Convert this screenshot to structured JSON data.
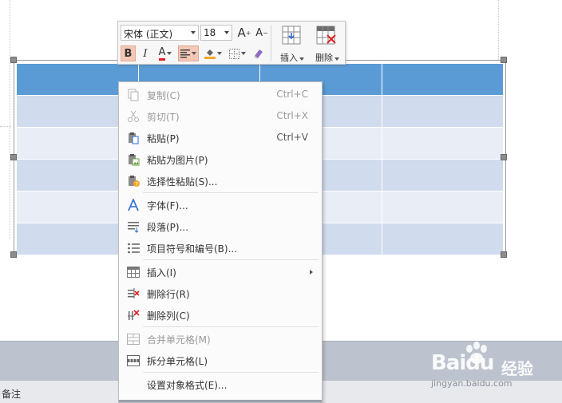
{
  "mini_toolbar": {
    "font_name": "宋体 (正文)",
    "font_size": "18",
    "grow_font_label": "A",
    "shrink_font_label": "A",
    "bold_label": "B",
    "italic_label": "I",
    "font_color_label": "A",
    "insert_label": "插入",
    "delete_label": "删除",
    "colors": {
      "font_color": "#e02020",
      "fill_color": "#f5a623",
      "active_bg": "#f4c7b6"
    }
  },
  "context_menu": {
    "items": [
      {
        "label": "复制(C)",
        "shortcut": "Ctrl+C",
        "icon": "copy-icon",
        "disabled": true
      },
      {
        "label": "剪切(T)",
        "shortcut": "Ctrl+X",
        "icon": "scissors-icon",
        "disabled": true
      },
      {
        "label": "粘贴(P)",
        "shortcut": "Ctrl+V",
        "icon": "paste-icon",
        "disabled": false
      },
      {
        "label": "粘贴为图片(P)",
        "shortcut": "",
        "icon": "paste-picture-icon",
        "disabled": false
      },
      {
        "label": "选择性粘贴(S)...",
        "shortcut": "",
        "icon": "paste-special-icon",
        "disabled": false
      },
      {
        "label": "字体(F)...",
        "shortcut": "",
        "icon": "font-icon",
        "disabled": false
      },
      {
        "label": "段落(P)...",
        "shortcut": "",
        "icon": "paragraph-icon",
        "disabled": false
      },
      {
        "label": "项目符号和编号(B)...",
        "shortcut": "",
        "icon": "bullets-icon",
        "disabled": false
      },
      {
        "label": "插入(I)",
        "shortcut": "",
        "icon": "table-insert-icon",
        "disabled": false,
        "submenu": true
      },
      {
        "label": "删除行(R)",
        "shortcut": "",
        "icon": "delete-row-icon",
        "disabled": false
      },
      {
        "label": "删除列(C)",
        "shortcut": "",
        "icon": "delete-column-icon",
        "disabled": false
      },
      {
        "label": "合并单元格(M)",
        "shortcut": "",
        "icon": "merge-cells-icon",
        "disabled": true
      },
      {
        "label": "拆分单元格(L)",
        "shortcut": "",
        "icon": "split-cells-icon",
        "disabled": false
      },
      {
        "label": "设置对象格式(E)...",
        "shortcut": "",
        "icon": "",
        "disabled": false
      }
    ]
  },
  "table": {
    "header_color": "#5b9bd5",
    "band_color_1": "#d0dbee",
    "band_color_2": "#e9edf6"
  },
  "notes": {
    "label": "备注"
  },
  "watermark": {
    "brand": "Bai",
    "brand2": "du",
    "product": "经验",
    "url": "jingyan.baidu.com"
  }
}
